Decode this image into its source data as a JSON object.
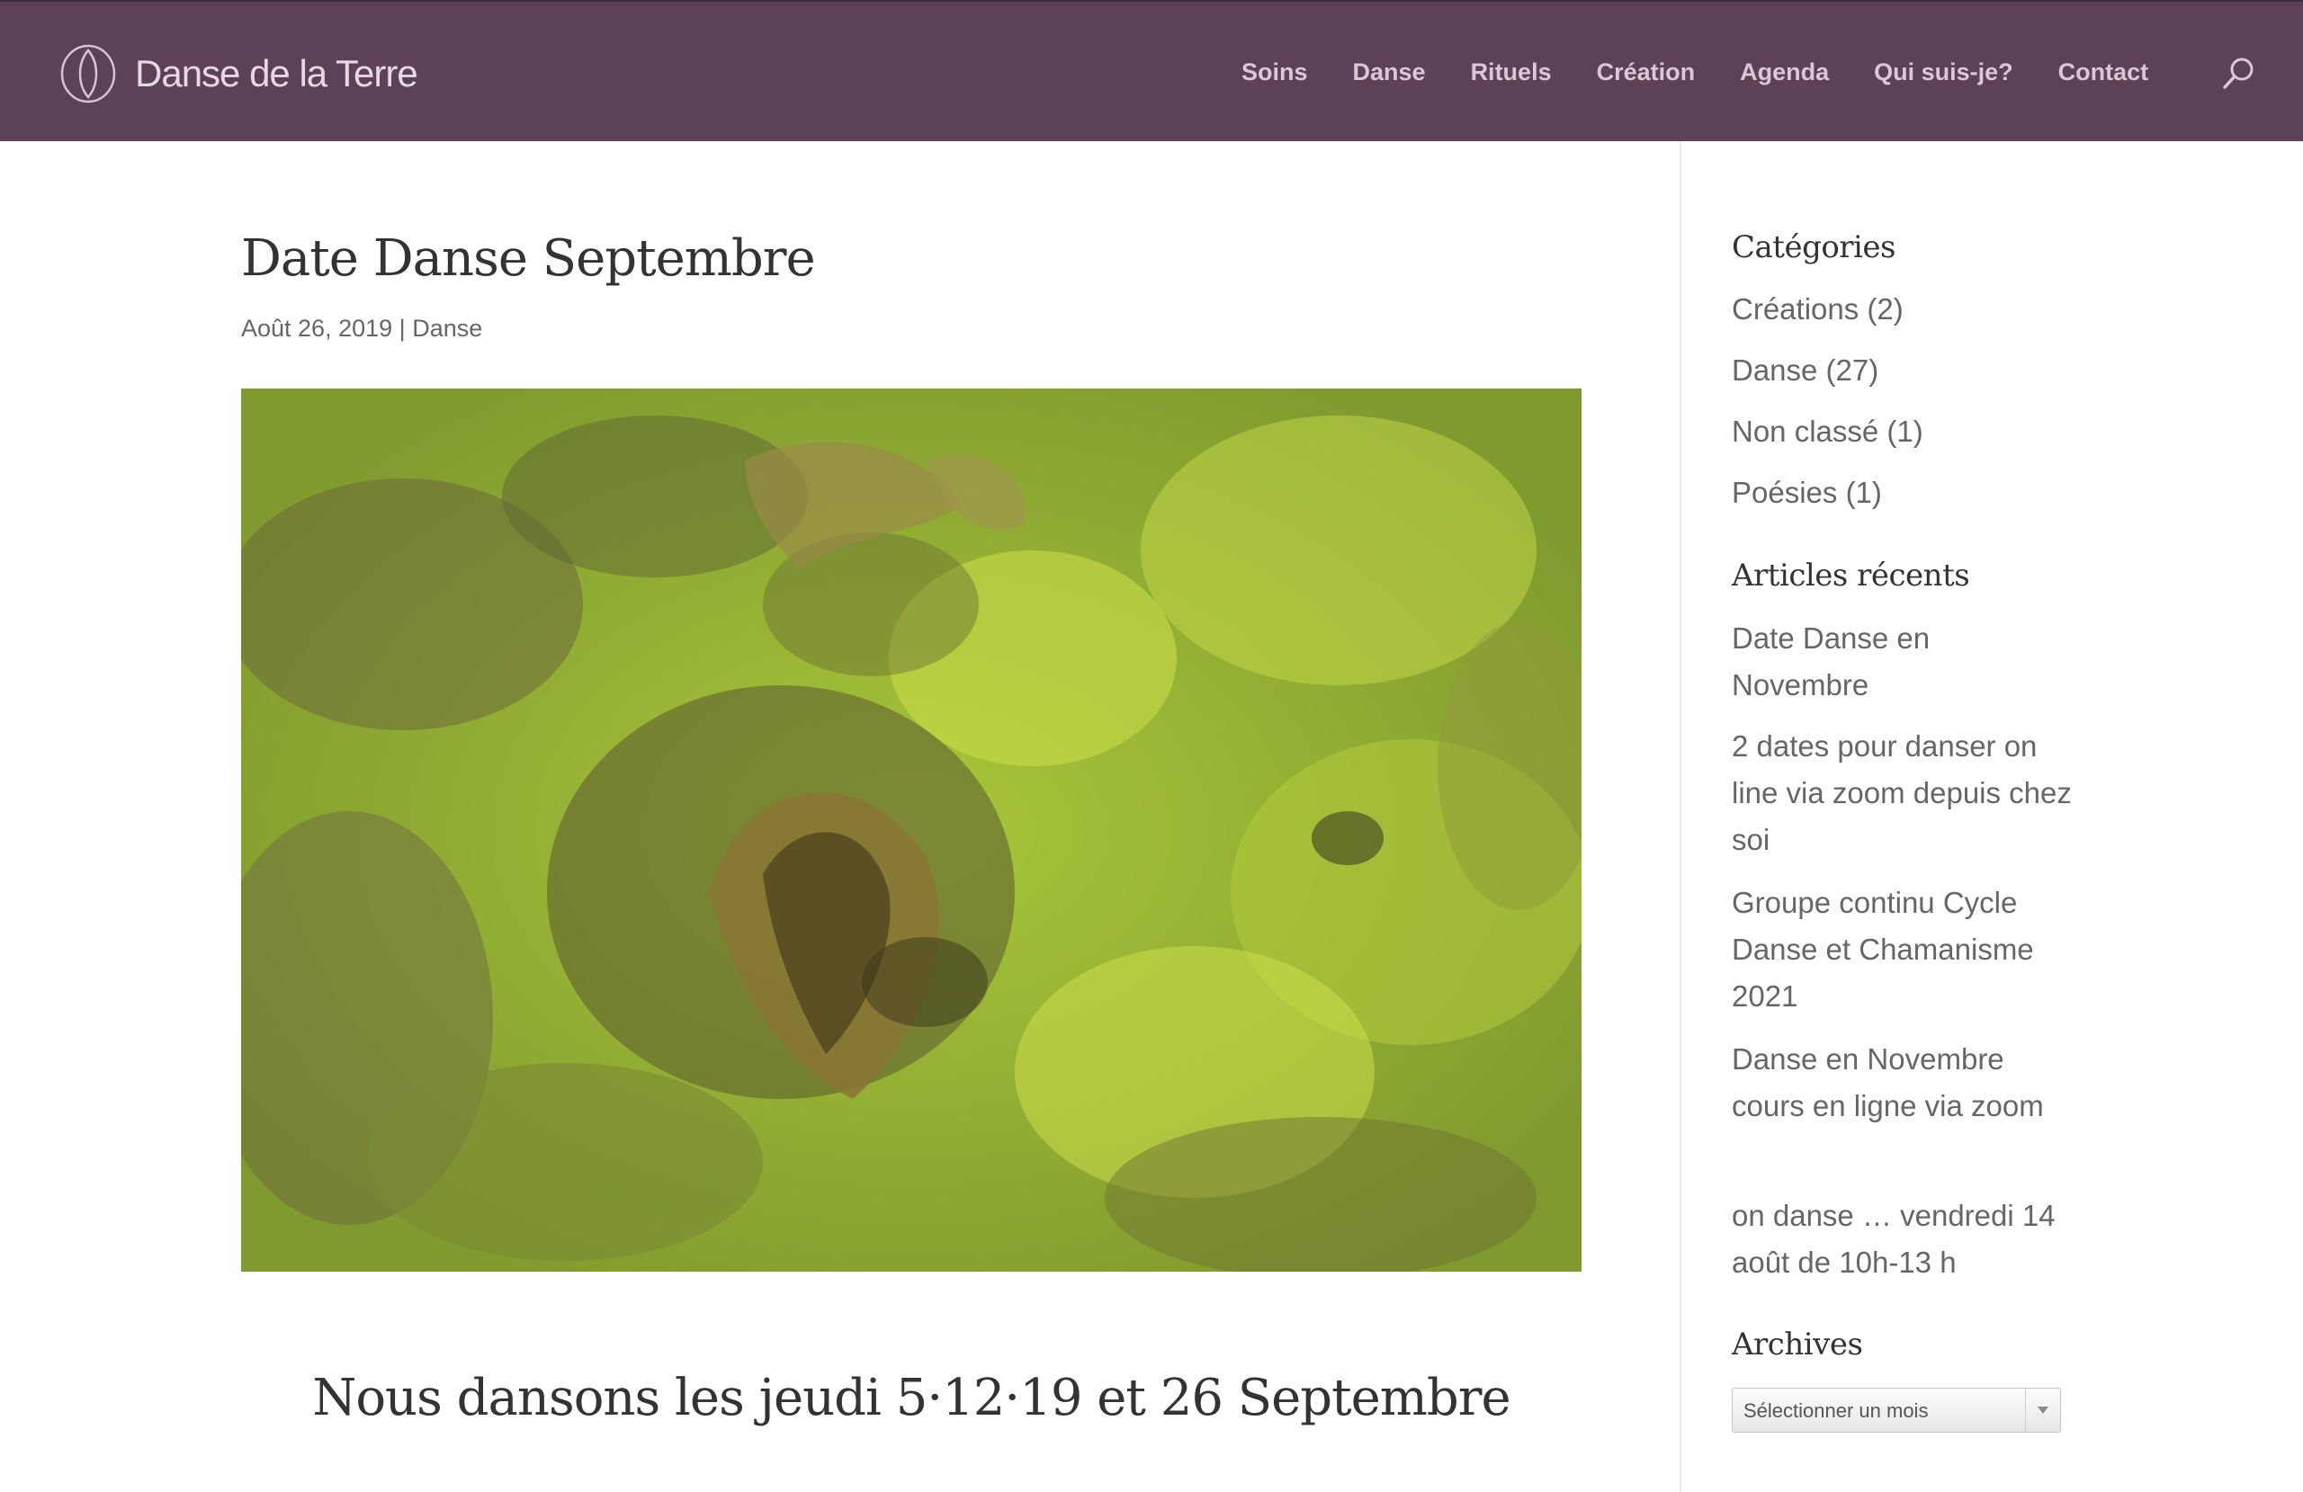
{
  "site": {
    "name": "Danse de la Terre"
  },
  "nav": {
    "items": [
      "Soins",
      "Danse",
      "Rituels",
      "Création",
      "Agenda",
      "Qui suis-je?",
      "Contact"
    ]
  },
  "post": {
    "title": "Date Danse Septembre",
    "date": "Août 26, 2019",
    "separator": "|",
    "category": "Danse",
    "heading": "Nous dansons les jeudi 5·12·19 et 26 Septembre"
  },
  "sidebar": {
    "categories_title": "Catégories",
    "categories": [
      "Créations (2)",
      "Danse (27)",
      "Non classé (1)",
      "Poésies (1)"
    ],
    "recent_title": "Articles récents",
    "recent": [
      "Date Danse en Novembre",
      "2 dates pour danser on line via zoom depuis chez soi",
      "Groupe continu Cycle Danse et Chamanisme 2021",
      "Danse en Novembre cours en ligne via zoom",
      "on danse … vendredi 14 août de 10h-13 h"
    ],
    "archives_title": "Archives",
    "archives_select": "Sélectionner un mois"
  },
  "colors": {
    "header_bg": "#5d4157",
    "nav_text": "#dcc6d7",
    "logo_text": "#e7d8e4"
  },
  "icons": {
    "logo": "leaf-circle-icon",
    "search": "search-icon",
    "select_arrow": "triangle-down-icon"
  }
}
